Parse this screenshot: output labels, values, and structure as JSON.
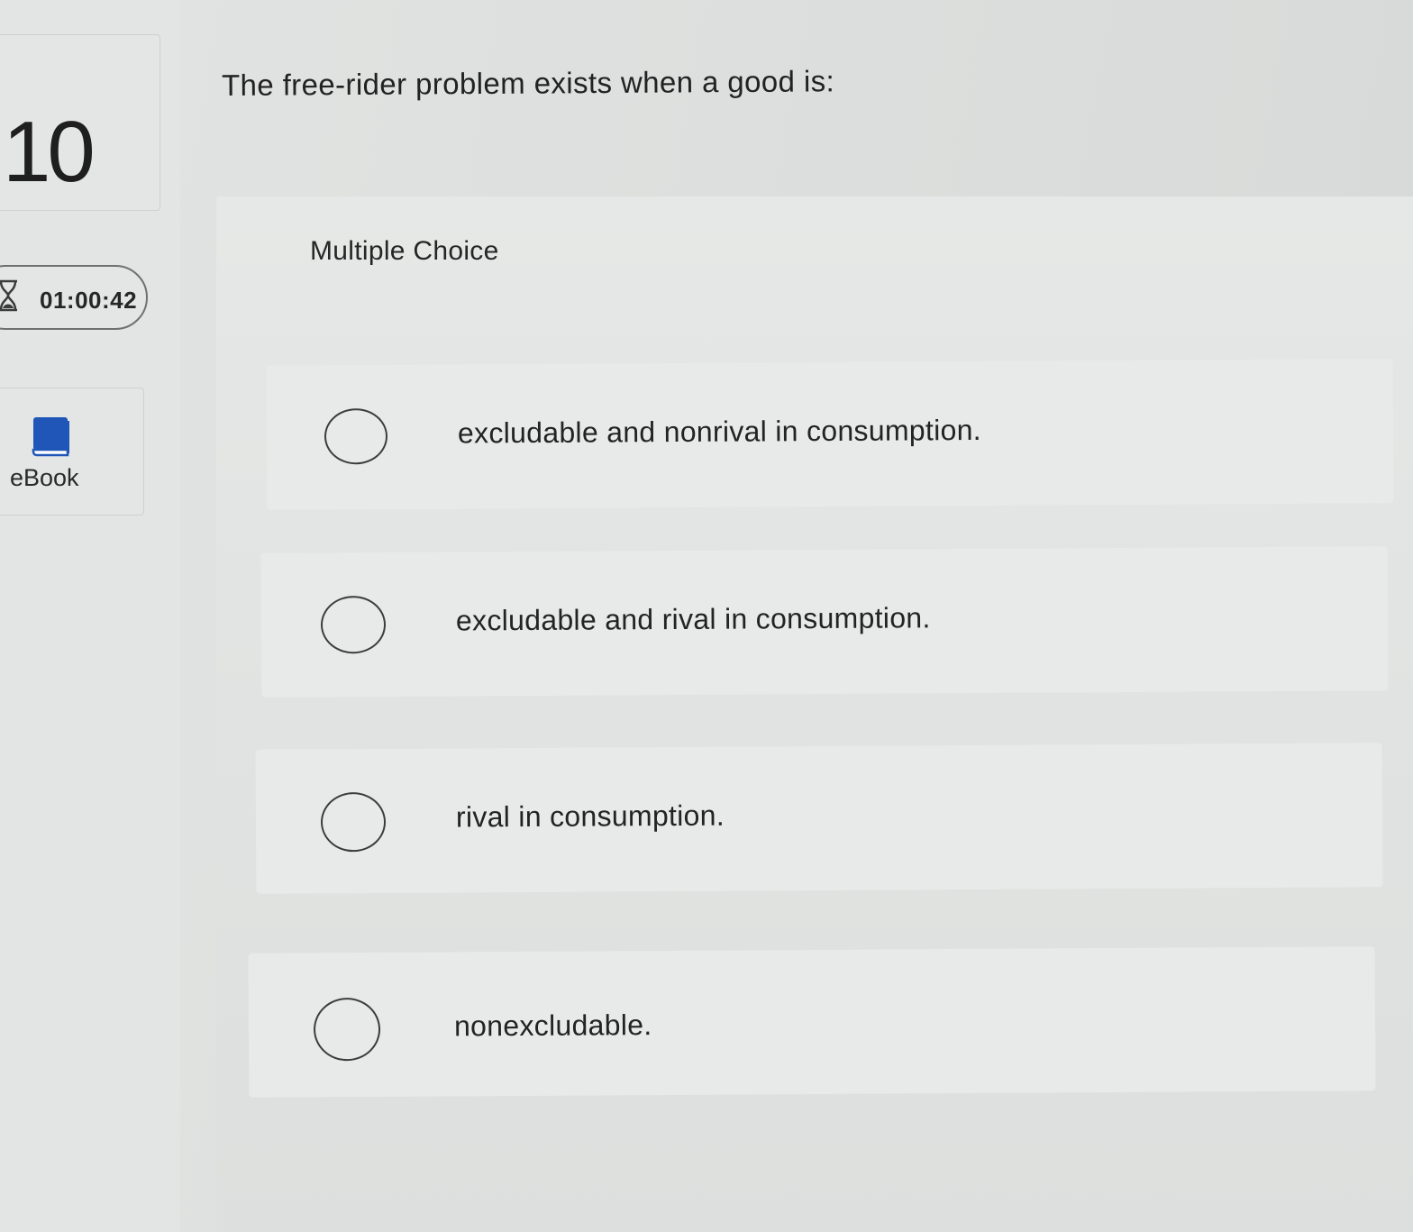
{
  "question": {
    "number": "10",
    "prompt": "The free-rider problem exists when a good is:"
  },
  "timer": {
    "icon": "hourglass-icon",
    "value": "01:00:42"
  },
  "ebook": {
    "icon": "book-icon",
    "label": "eBook",
    "icon_color": "#1f56b8"
  },
  "answers": {
    "type_label": "Multiple Choice",
    "options": [
      {
        "label": "excludable and nonrival in consumption."
      },
      {
        "label": "excludable and rival in consumption."
      },
      {
        "label": "rival in consumption."
      },
      {
        "label": "nonexcludable."
      }
    ]
  }
}
